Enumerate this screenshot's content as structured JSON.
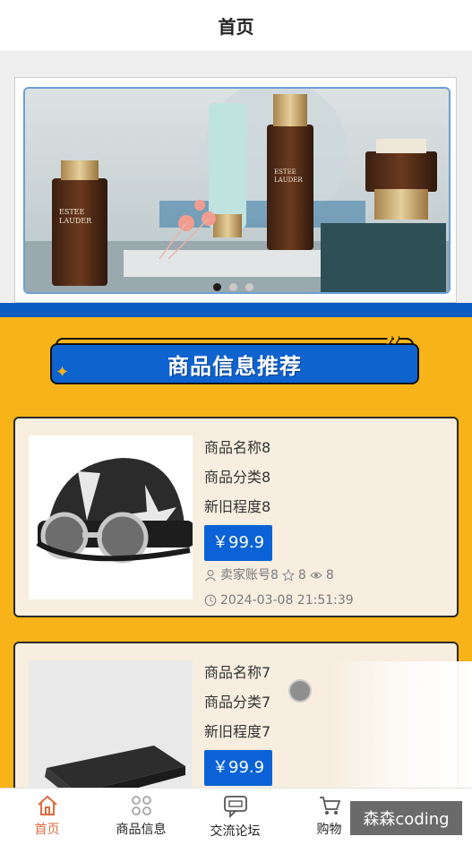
{
  "header": {
    "title": "首页"
  },
  "banner": {
    "alt": "ESTEE LAUDER Advanced Night Repair",
    "slides": 3,
    "active_slide": 1
  },
  "section": {
    "title": "商品信息推荐",
    "quote": "”"
  },
  "products": [
    {
      "name": "商品名称8",
      "category": "商品分类8",
      "condition": "新旧程度8",
      "price": "￥99.9",
      "seller": "卖家账号8",
      "stars": "8",
      "views": "8",
      "time": "2024-03-08 21:51:39",
      "image_icon": "helmet-image"
    },
    {
      "name": "商品名称7",
      "category": "商品分类7",
      "condition": "新旧程度7",
      "price": "￥99.9",
      "image_icon": "laptop-image"
    }
  ],
  "tabbar": {
    "items": [
      {
        "label": "首页",
        "icon": "home-icon",
        "active": true
      },
      {
        "label": "商品信息",
        "icon": "grid-icon",
        "active": false
      },
      {
        "label": "交流论坛",
        "icon": "chat-icon",
        "active": false
      },
      {
        "label": "购物",
        "icon": "cart-icon",
        "active": false
      }
    ]
  },
  "watermark": "森森coding",
  "colors": {
    "accent": "#0b62d6",
    "background": "#f7b318",
    "active_tab": "#e06a3d",
    "card": "#f7eedf"
  }
}
